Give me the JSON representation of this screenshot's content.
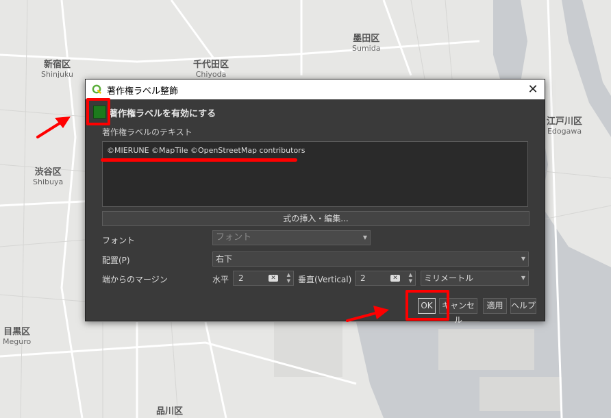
{
  "map": {
    "labels": [
      {
        "jp": "新宿区",
        "en": "Shinjuku"
      },
      {
        "jp": "千代田区",
        "en": "Chiyoda"
      },
      {
        "jp": "墨田区",
        "en": "Sumida"
      },
      {
        "jp": "渋谷区",
        "en": "Shibuya"
      },
      {
        "jp": "江戸川区",
        "en": "Edogawa"
      },
      {
        "jp": "目黒区",
        "en": "Meguro"
      },
      {
        "jp": "品川区",
        "en": ""
      }
    ]
  },
  "dialog": {
    "title": "著作権ラベル整飾",
    "close_glyph": "✕",
    "enable_label": "著作権ラベルを有効にする",
    "enabled": true,
    "text_section_label": "著作権ラベルのテキスト",
    "copyright_text": "©MIERUNE ©MapTile ©OpenStreetMap contributors",
    "expression_button": "式の挿入・編集...",
    "font_label": "フォント",
    "font_button": "フォント",
    "placement_label": "配置(P)",
    "placement_value": "右下",
    "margin_label": "端からのマージン",
    "horizontal_label": "水平",
    "horizontal_value": "2",
    "vertical_label": "垂直(Vertical)",
    "vertical_value": "2",
    "unit_value": "ミリメートル",
    "buttons": {
      "ok": "OK",
      "cancel": "キャンセル",
      "apply": "適用",
      "help": "ヘルプ"
    }
  },
  "annotation_color": "#ff0000",
  "qgis_icon_color": "#5aae3a"
}
